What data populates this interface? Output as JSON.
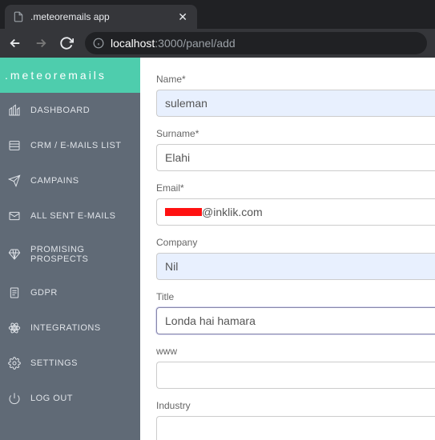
{
  "browser": {
    "tab_title": ".meteoremails app",
    "url_host": "localhost",
    "url_path": ":3000/panel/add"
  },
  "brand": ".meteoremails",
  "sidebar": {
    "items": [
      {
        "label": "DASHBOARD"
      },
      {
        "label": "CRM / E-MAILS LIST"
      },
      {
        "label": "CAMPAINS"
      },
      {
        "label": "ALL SENT E-MAILS"
      },
      {
        "label": "PROMISING PROSPECTS"
      },
      {
        "label": "GDPR"
      },
      {
        "label": "INTEGRATIONS"
      },
      {
        "label": "SETTINGS"
      },
      {
        "label": "LOG OUT"
      }
    ]
  },
  "form": {
    "name": {
      "label": "Name*",
      "value": "suleman"
    },
    "surname": {
      "label": "Surname*",
      "value": "Elahi"
    },
    "email": {
      "label": "Email*",
      "value_visible_suffix": "@inklik.com"
    },
    "company": {
      "label": "Company",
      "value": "Nil"
    },
    "title": {
      "label": "Title",
      "value": "Londa hai hamara"
    },
    "www": {
      "label": "www",
      "value": ""
    },
    "industry": {
      "label": "Industry",
      "value": ""
    }
  }
}
